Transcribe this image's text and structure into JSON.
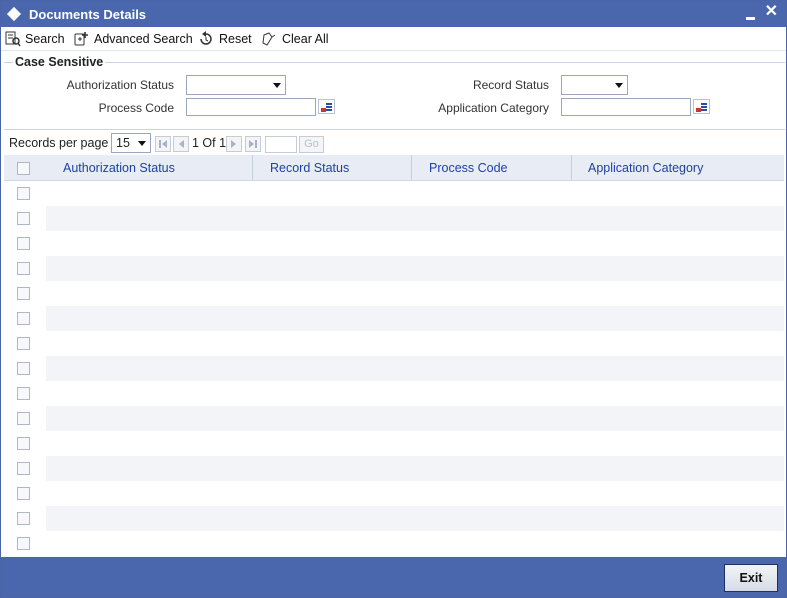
{
  "window": {
    "title": "Documents Details"
  },
  "toolbar": {
    "search": "Search",
    "advanced_search": "Advanced Search",
    "reset": "Reset",
    "clear_all": "Clear All"
  },
  "criteria": {
    "legend": "Case Sensitive",
    "authorization_status_label": "Authorization Status",
    "authorization_status_value": "",
    "record_status_label": "Record Status",
    "record_status_value": "",
    "process_code_label": "Process Code",
    "process_code_value": "",
    "application_category_label": "Application Category",
    "application_category_value": ""
  },
  "pager": {
    "records_per_page_label": "Records per page",
    "records_per_page_value": "15",
    "page_text": "1 Of 1",
    "goto_value": "",
    "go_label": "Go"
  },
  "grid": {
    "columns": [
      "Authorization Status",
      "Record Status",
      "Process Code",
      "Application Category"
    ],
    "row_count": 15
  },
  "footer": {
    "exit_label": "Exit"
  },
  "colors": {
    "frame_blue": "#4a67ad",
    "header_link": "#1f3fa8",
    "row_alt": "#f2f4f8"
  }
}
